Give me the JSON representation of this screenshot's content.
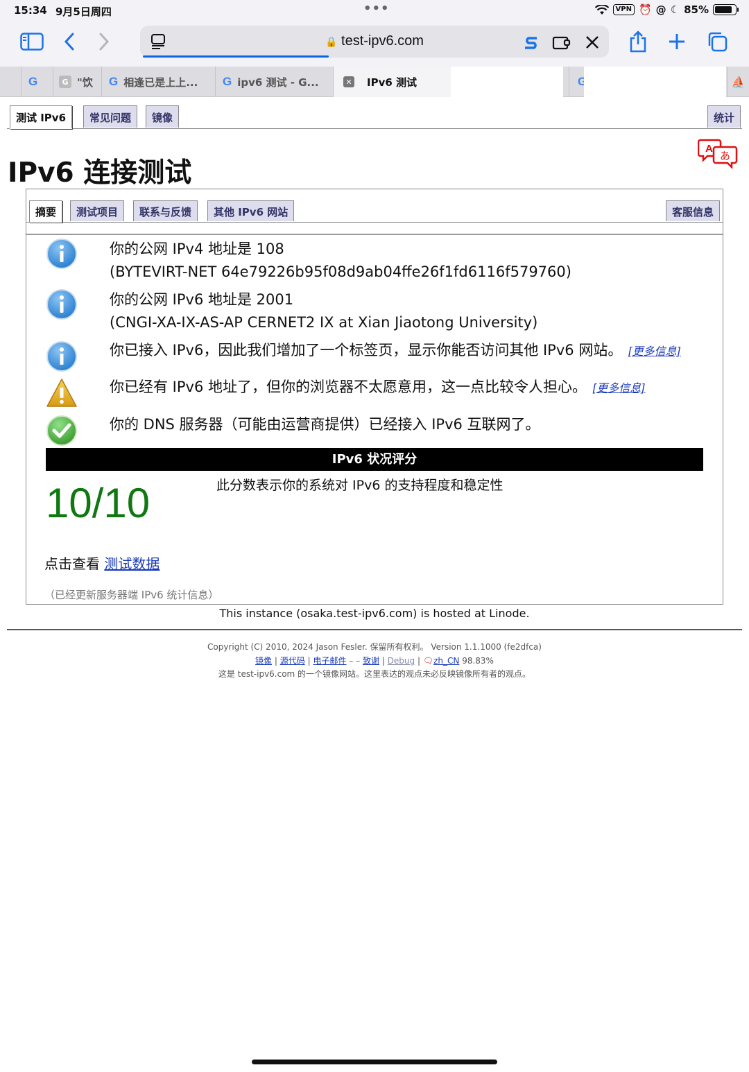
{
  "status_bar": {
    "time": "15:34",
    "date": "9月5日周四",
    "vpn": "VPN",
    "battery": "85%",
    "battery_level": 0.85
  },
  "browser": {
    "url": "test-ipv6.com",
    "tabs": [
      {
        "label": "",
        "icon": "google-icon"
      },
      {
        "label": "\"饮",
        "icon": "generic-favicon"
      },
      {
        "label": "相逢已是上上...",
        "icon": "google-icon"
      },
      {
        "label": "ipv6 测试 - G...",
        "icon": "google-icon"
      },
      {
        "label": "IPv6 测试",
        "icon": "close-icon",
        "active": true
      }
    ]
  },
  "nav": {
    "tabs": [
      "测试 IPv6",
      "常见问题",
      "镜像"
    ],
    "right_tab": "统计"
  },
  "page_title": "IPv6 连接测试",
  "inner_tabs": {
    "tabs": [
      "摘要",
      "测试项目",
      "联系与反馈",
      "其他 IPv6 网站"
    ],
    "right_tab": "客服信息"
  },
  "messages": [
    {
      "icon": "info-icon",
      "line1": "你的公网 IPv4 地址是 108",
      "line2": "(BYTEVIRT-NET 64e79226b95f08d9ab04ffe26f1fd6116f579760)"
    },
    {
      "icon": "info-icon",
      "line1": "你的公网 IPv6 地址是 2001",
      "line2": "(CNGI-XA-IX-AS-AP CERNET2 IX at Xian Jiaotong University)"
    },
    {
      "icon": "info-icon",
      "line1": "你已接入 IPv6，因此我们增加了一个标签页，显示你能否访问其他 IPv6 网站。",
      "link": "[更多信息]"
    },
    {
      "icon": "warning-icon",
      "line1": "你已经有 IPv6 地址了，但你的浏览器不太愿意用，这一点比较令人担心。",
      "link": "[更多信息]"
    },
    {
      "icon": "check-icon",
      "line1": "你的 DNS 服务器（可能由运营商提供）已经接入 IPv6 互联网了。"
    }
  ],
  "score": {
    "header": "IPv6 状况评分",
    "value": "10/10",
    "description": "此分数表示你的系统对 IPv6 的支持程度和稳定性"
  },
  "click_view": {
    "prefix": "点击查看",
    "link": "测试数据"
  },
  "stats_note": "（已经更新服务器端 IPv6 统计信息）",
  "hosted": "This instance (osaka.test-ipv6.com) is hosted at Linode.",
  "footer": {
    "copyright": "Copyright (C) 2010, 2024 Jason Fesler. 保留所有权利。 Version 1.1.1000 (fe2dfca)",
    "links": {
      "mirror": "镜像",
      "source": "源代码",
      "email": "电子邮件",
      "thanks": "致谢",
      "debug": "Debug",
      "locale": "zh_CN",
      "percent": "98.83%"
    },
    "sep1": "|",
    "dash": "–   –",
    "note": "这是 test-ipv6.com 的一个镜像网站。这里表达的观点未必反映镜像所有者的观点。"
  }
}
